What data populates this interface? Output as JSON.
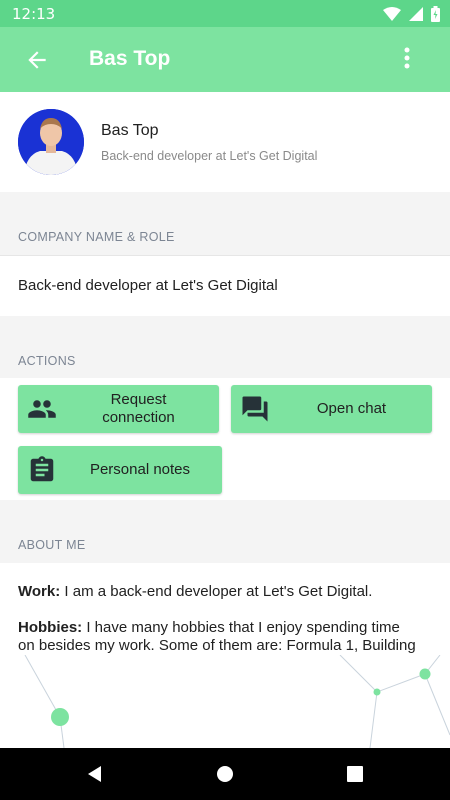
{
  "status_bar": {
    "time": "12:13"
  },
  "app_bar": {
    "title": "Bas Top"
  },
  "profile": {
    "name": "Bas Top",
    "role": "Back-end developer at Let's Get Digital"
  },
  "sections": {
    "company": {
      "header": "COMPANY NAME & ROLE",
      "value": "Back-end developer at Let's Get Digital"
    },
    "actions": {
      "header": "ACTIONS",
      "buttons": [
        {
          "label_line1": "Request",
          "label_line2": "connection",
          "icon": "people-icon"
        },
        {
          "label": "Open chat",
          "icon": "chat-icon"
        },
        {
          "label": "Personal notes",
          "icon": "clipboard-icon"
        }
      ]
    },
    "about": {
      "header": "ABOUT ME",
      "work_label": "Work:",
      "work_text": " I am a back-end developer at Let's Get Digital.",
      "hobbies_label": "Hobbies:",
      "hobbies_text_1": " I have many hobbies that I enjoy spending time",
      "hobbies_text_2": "on besides my work. Some of them are: Formula 1, Building"
    }
  },
  "colors": {
    "status_bar": "#5dd68a",
    "app_bar": "#7de3a0",
    "button": "#7de3a0",
    "avatar_bg": "#1a32d4"
  }
}
